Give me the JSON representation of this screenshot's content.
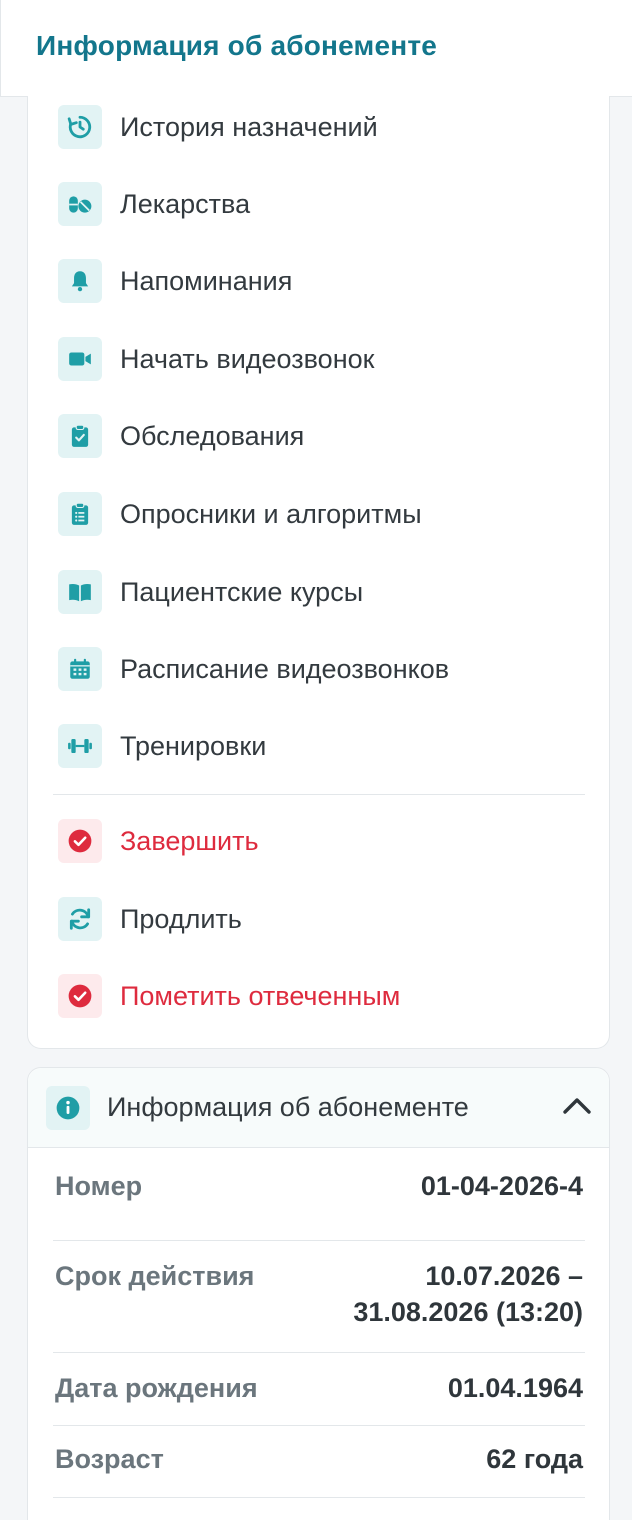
{
  "header": {
    "title": "Информация об абонементе"
  },
  "menu": {
    "items": [
      {
        "icon": "history-icon",
        "label": "История назначений"
      },
      {
        "icon": "pills-icon",
        "label": "Лекарства"
      },
      {
        "icon": "bell-icon",
        "label": "Напоминания"
      },
      {
        "icon": "video-camera-icon",
        "label": "Начать видеозвонок"
      },
      {
        "icon": "clipboard-check-icon",
        "label": "Обследования"
      },
      {
        "icon": "clipboard-list-icon",
        "label": "Опросники и алгоритмы"
      },
      {
        "icon": "book-open-icon",
        "label": "Пациентские курсы"
      },
      {
        "icon": "calendar-icon",
        "label": "Расписание видеозвонков"
      },
      {
        "icon": "dumbbell-icon",
        "label": "Тренировки"
      }
    ],
    "actions": [
      {
        "icon": "check-circle-icon",
        "label": "Завершить",
        "danger": true
      },
      {
        "icon": "refresh-icon",
        "label": "Продлить",
        "danger": false
      },
      {
        "icon": "check-circle-icon",
        "label": "Пометить отвеченным",
        "danger": true
      }
    ]
  },
  "info": {
    "title": "Информация об абонементе",
    "icon": "info-icon",
    "expanded": true,
    "rows": [
      {
        "label": "Номер",
        "value_line1": "01-04-2026-4",
        "value_line2": ""
      },
      {
        "label": "Срок действия",
        "value_line1": "10.07.2026 –",
        "value_line2": "31.08.2026 (13:20)"
      },
      {
        "label": "Дата рождения",
        "value_line1": "01.04.1964",
        "value_line2": ""
      },
      {
        "label": "Возраст",
        "value_line1": "62 года",
        "value_line2": ""
      }
    ]
  },
  "colors": {
    "accent": "#13768c",
    "icon_teal": "#1f9ea6",
    "icon_bg": "#e2f3f4",
    "danger": "#de2b3e",
    "danger_bg": "#fdeaec",
    "text": "#333a3f",
    "muted": "#6b767d"
  }
}
